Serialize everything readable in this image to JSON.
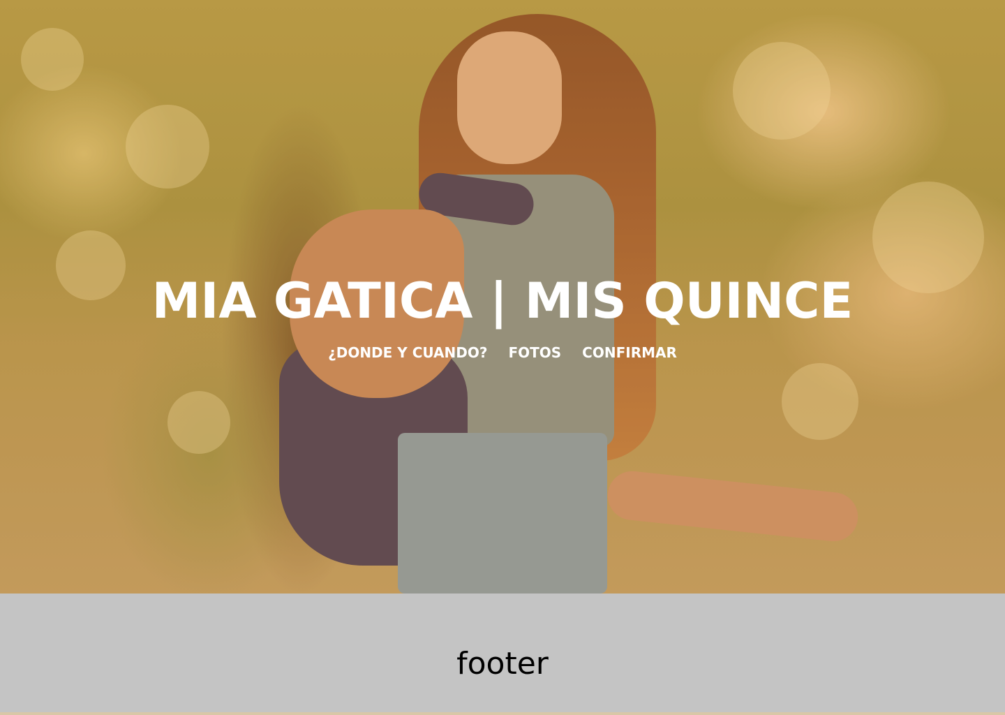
{
  "hero": {
    "title": "MIA GATICA | MIS QUINCE",
    "background_image": "girl-with-backpack-photo",
    "overlay_color": "#c89646"
  },
  "nav": {
    "items": [
      {
        "label": "¿DONDE Y CUANDO?"
      },
      {
        "label": "FOTOS"
      },
      {
        "label": "CONFIRMAR"
      }
    ]
  },
  "footer": {
    "text": "footer",
    "background_color": "#c4c4c4"
  }
}
